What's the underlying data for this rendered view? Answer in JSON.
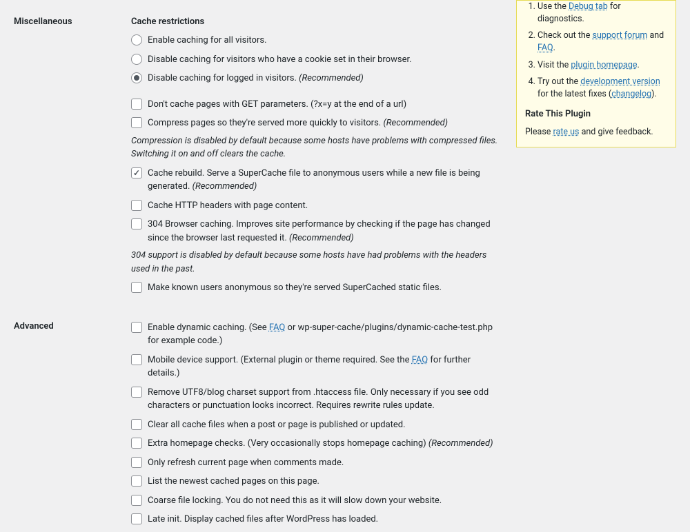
{
  "sections": {
    "misc": {
      "label": "Miscellaneous",
      "title": "Cache restrictions",
      "radios": [
        "Enable caching for all visitors.",
        "Disable caching for visitors who have a cookie set in their browser.",
        "Disable caching for logged in visitors. "
      ],
      "radio_rec": "(Recommended)",
      "checks": [
        "Don't cache pages with GET parameters. (?x=y at the end of a url)",
        "Compress pages so they're served more quickly to visitors. ",
        "Cache rebuild. Serve a SuperCache file to anonymous users while a new file is being generated. ",
        "Cache HTTP headers with page content.",
        "304 Browser caching. Improves site performance by checking if the page has changed since the browser last requested it. ",
        "Make known users anonymous so they're served SuperCached static files."
      ],
      "rec": "(Recommended)",
      "notes": {
        "compression": "Compression is disabled by default because some hosts have problems with compressed files. Switching it on and off clears the cache.",
        "304": "304 support is disabled by default because some hosts have had problems with the headers used in the past."
      }
    },
    "advanced": {
      "label": "Advanced",
      "checks": {
        "dynamic_pre": "Enable dynamic caching. (See ",
        "dynamic_link": "FAQ",
        "dynamic_post": " or wp-super-cache/plugins/dynamic-cache-test.php for example code.)",
        "mobile_pre": "Mobile device support. (External plugin or theme required. See the ",
        "mobile_link": "FAQ",
        "mobile_post": " for further details.)",
        "utf8": "Remove UTF8/blog charset support from .htaccess file. Only necessary if you see odd characters or punctuation looks incorrect. Requires rewrite rules update.",
        "clear": "Clear all cache files when a post or page is published or updated.",
        "extra": "Extra homepage checks. (Very occasionally stops homepage caching) ",
        "refresh": "Only refresh current page when comments made.",
        "newest": "List the newest cached pages on this page.",
        "coarse": "Coarse file locking. You do not need this as it will slow down your website.",
        "late": "Late init. Display cached files after WordPress has loaded."
      },
      "rec": "(Recommended)"
    }
  },
  "sidebar": {
    "items": {
      "i1_pre": "Use the ",
      "i1_link": "Debug tab",
      "i1_post": " for diagnostics.",
      "i2_pre": "Check out the ",
      "i2_link1": "support forum",
      "i2_mid": " and ",
      "i2_link2": "FAQ",
      "i2_post": ".",
      "i3_pre": "Visit the ",
      "i3_link": "plugin homepage",
      "i3_post": ".",
      "i4_pre": "Try out the ",
      "i4_link1": "development version",
      "i4_mid": " for the latest fixes (",
      "i4_link2": "changelog",
      "i4_post": ")."
    },
    "rate_heading": "Rate This Plugin",
    "rate_pre": "Please ",
    "rate_link": "rate us",
    "rate_post": " and give feedback."
  }
}
